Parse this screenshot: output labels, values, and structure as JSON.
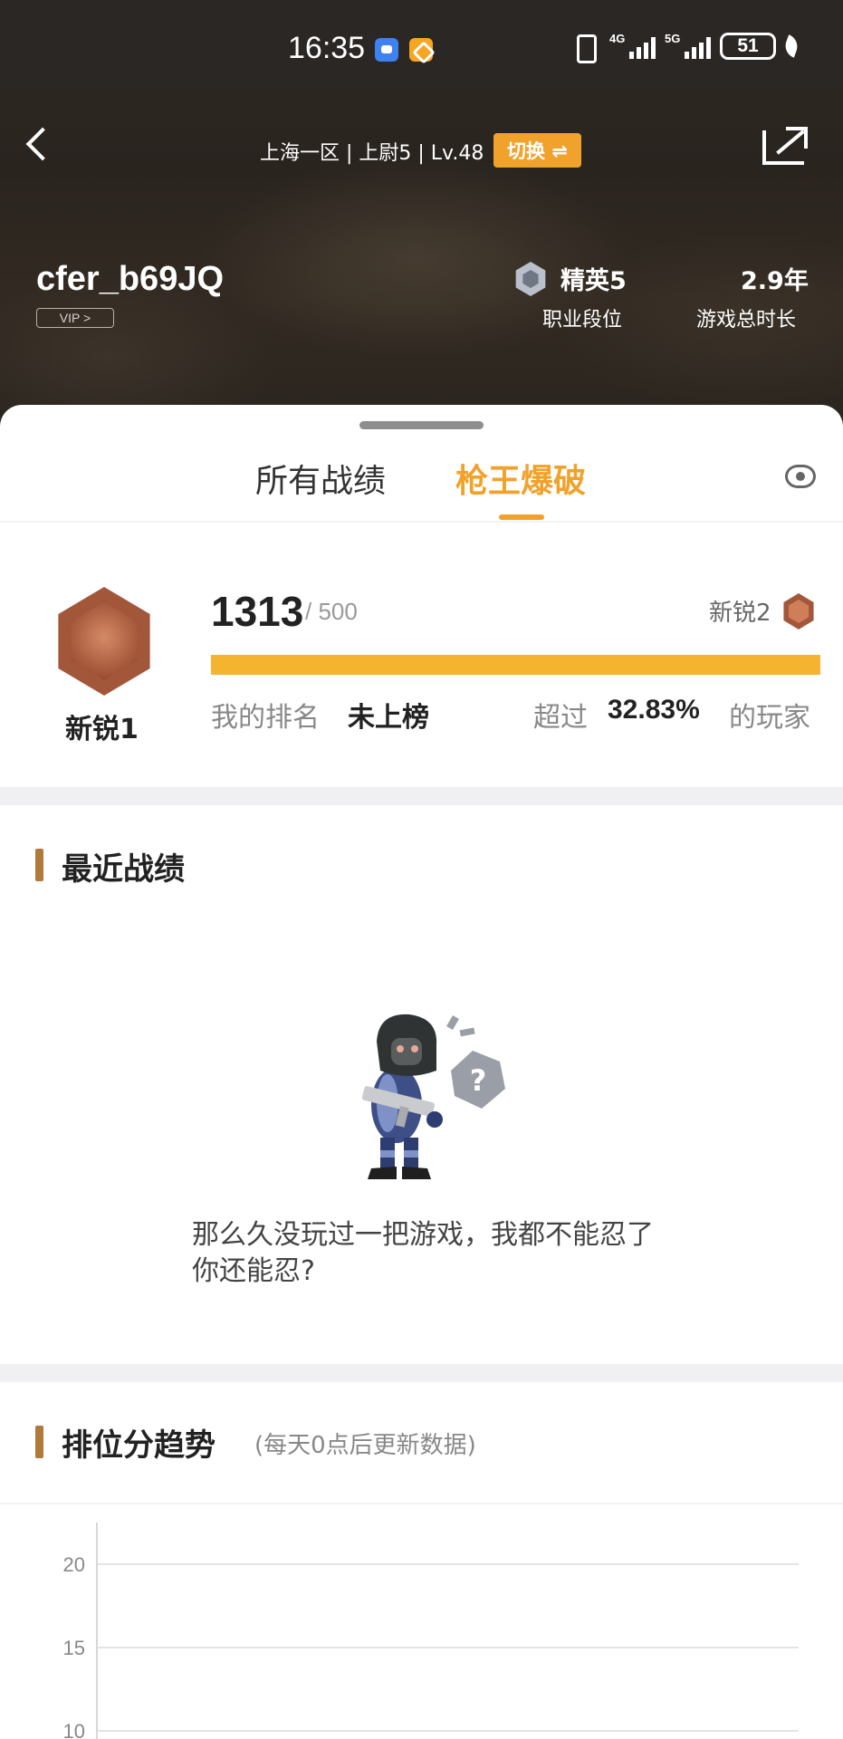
{
  "status_bar": {
    "time": "16:35",
    "net1": "4G",
    "net2": "5G",
    "battery": "51"
  },
  "header": {
    "server_info": "上海一区 | 上尉5 | Lv.48",
    "switch_label": "切换 ⇌",
    "username": "cfer_b69JQ",
    "vip_label": "VIP >",
    "rank_value": "精英5",
    "rank_label": "职业段位",
    "playtime_value": "2.9年",
    "playtime_label": "游戏总时长"
  },
  "tabs": {
    "all": "所有战绩",
    "active": "枪王爆破"
  },
  "rank_card": {
    "badge_label": "新锐1",
    "score": "1313",
    "score_max": "/ 500",
    "next_tier": "新锐2",
    "progress_fraction": 1.0,
    "my_rank_label": "我的排名",
    "my_rank_value": "未上榜",
    "exceed_label": "超过",
    "exceed_value": "32.83%",
    "exceed_suffix": "的玩家"
  },
  "recent": {
    "title": "最近战绩",
    "empty_message": "那么久没玩过一把游戏，我都不能忍了你还能忍?"
  },
  "trend": {
    "title": "排位分趋势",
    "note": "(每天0点后更新数据)"
  },
  "chart_data": {
    "type": "line",
    "title": "",
    "xlabel": "",
    "ylabel": "",
    "y_ticks": [
      20,
      15,
      10
    ],
    "ylim": [
      10,
      20
    ],
    "grid": true,
    "series": []
  },
  "colors": {
    "accent": "#f1a22c",
    "progress": "#f4b430",
    "section_bar": "#b07b3a"
  }
}
